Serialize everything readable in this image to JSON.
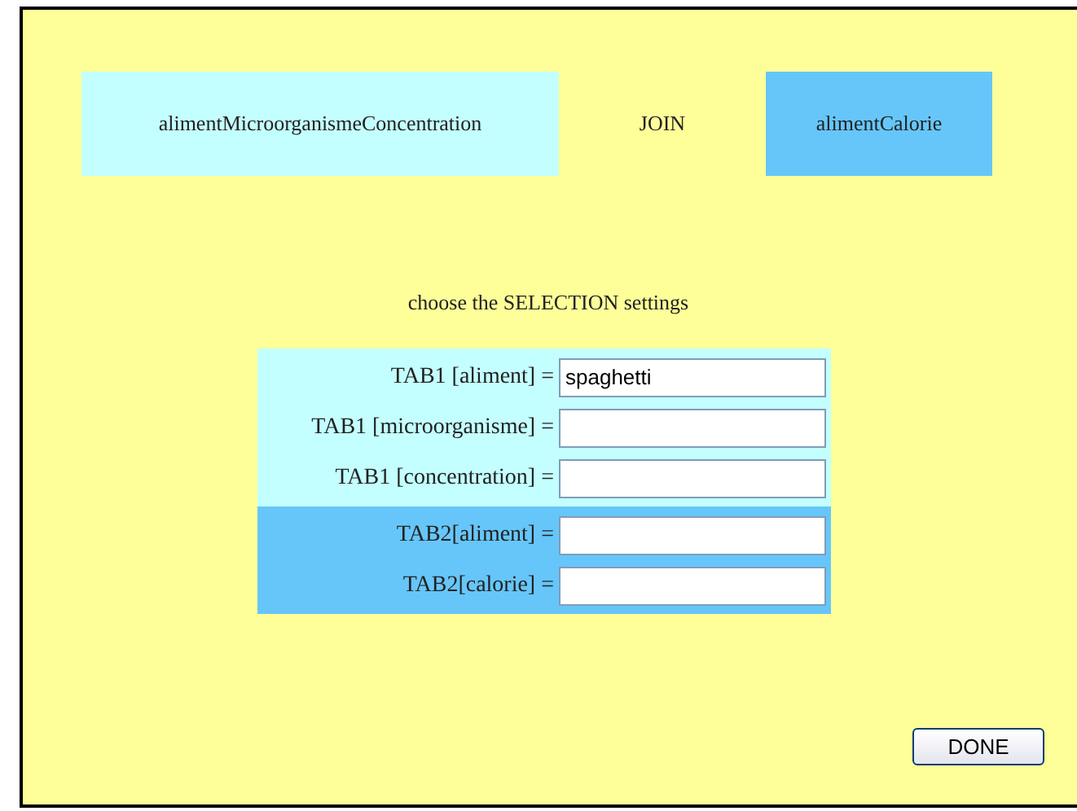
{
  "tables": [
    {
      "name": "alimentMicroorganismeConcentration",
      "color": "#c4ffff"
    },
    {
      "name": "alimentCalorie",
      "color": "#66c6fa"
    }
  ],
  "join_label": "JOIN",
  "instruction": "choose the SELECTION settings",
  "field_groups": [
    {
      "color": "#c4ffff",
      "fields": [
        {
          "label": "TAB1 [aliment] =",
          "value": "spaghetti"
        },
        {
          "label": "TAB1 [microorganisme] ="
        },
        {
          "label": "TAB1 [concentration] ="
        }
      ]
    },
    {
      "color": "#66c6fa",
      "fields": [
        {
          "label": "TAB2[aliment] ="
        },
        {
          "label": "TAB2[calorie] ="
        }
      ]
    }
  ],
  "done_button": "DONE"
}
